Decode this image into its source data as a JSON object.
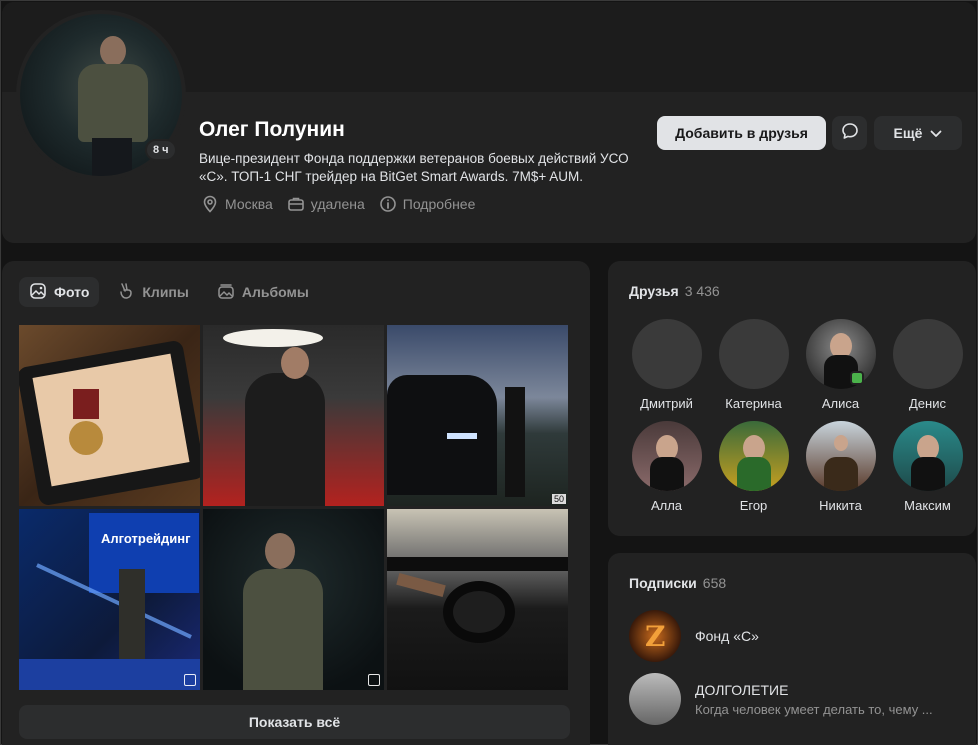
{
  "profile": {
    "name": "Олег Полунин",
    "online_time": "8 ч",
    "status": "Вице-президент Фонда поддержки ветеранов боевых действий УСО «С». ТОП-1 СНГ трейдер на BitGet Smart Awards. 7M$+ AUM.",
    "city": "Москва",
    "job": "удалена",
    "more_info": "Подробнее",
    "add_friend_label": "Добавить в друзья",
    "more_label": "Ещё"
  },
  "photos": {
    "tabs": [
      {
        "label": "Фото",
        "icon": "photo-icon",
        "active": true
      },
      {
        "label": "Клипы",
        "icon": "clips-icon",
        "active": false
      },
      {
        "label": "Альбомы",
        "icon": "albums-icon",
        "active": false
      }
    ],
    "badge_50": "50",
    "screen_text": "Алготрейдинг",
    "show_all": "Показать всё"
  },
  "friends": {
    "title": "Друзья",
    "count": "3 436",
    "items": [
      {
        "name": "Дмитрий"
      },
      {
        "name": "Катерина"
      },
      {
        "name": "Алиса",
        "online": true
      },
      {
        "name": "Денис"
      },
      {
        "name": "Алла"
      },
      {
        "name": "Егор"
      },
      {
        "name": "Никита"
      },
      {
        "name": "Максим"
      }
    ]
  },
  "subscriptions": {
    "title": "Подписки",
    "count": "658",
    "items": [
      {
        "name": "Фонд «С»",
        "desc": ""
      },
      {
        "name": "ДОЛГОЛЕТИЕ",
        "desc": "Когда человек умеет делать то, чему ..."
      }
    ]
  },
  "colors": {
    "background": "#141414",
    "card": "#222222",
    "button": "#2c2d2e",
    "primary_button": "#e1e3e6",
    "online": "#4bb34b"
  }
}
